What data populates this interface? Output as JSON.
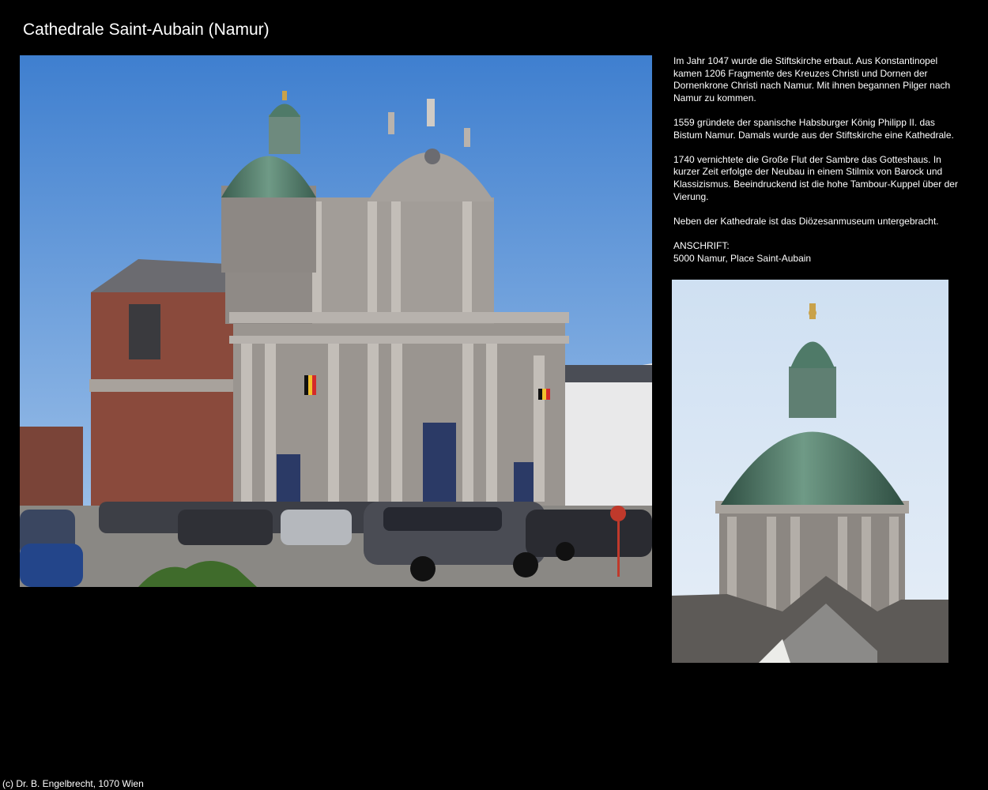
{
  "page": {
    "title": "Cathedrale Saint-Aubain (Namur)",
    "footer": "(c) Dr. B. Engelbrecht, 1070 Wien"
  },
  "description": {
    "paragraphs": [
      "Im Jahr 1047 wurde die Stiftskirche erbaut. Aus Konstantinopel kamen 1206 Fragmente des Kreuzes Christi und Dornen der Dornenkrone Christi nach Namur. Mit ihnen begannen Pilger nach Namur zu kommen.",
      "1559 gründete der spanische Habsburger König Philipp II. das Bistum Namur. Damals wurde aus der Stiftskirche eine Kathedrale.",
      "1740 vernichtete die Große Flut der Sambre das Gotteshaus. In kurzer Zeit erfolgte der Neubau in einem Stilmix von Barock und Klassizismus. Beeindruckend ist die hohe Tambour-Kuppel über der Vierung.",
      "Neben der Kathedrale ist das Diözesanmuseum untergebracht."
    ],
    "address_label": "ANSCHRIFT:",
    "address": "5000 Namur, Place Saint-Aubain"
  },
  "colors": {
    "background": "#000000",
    "text": "#ffffff",
    "sky": "#5b93d6",
    "dome_green": "#4f7a68",
    "stone": "#9a9590",
    "brick": "#8a4a3c"
  }
}
